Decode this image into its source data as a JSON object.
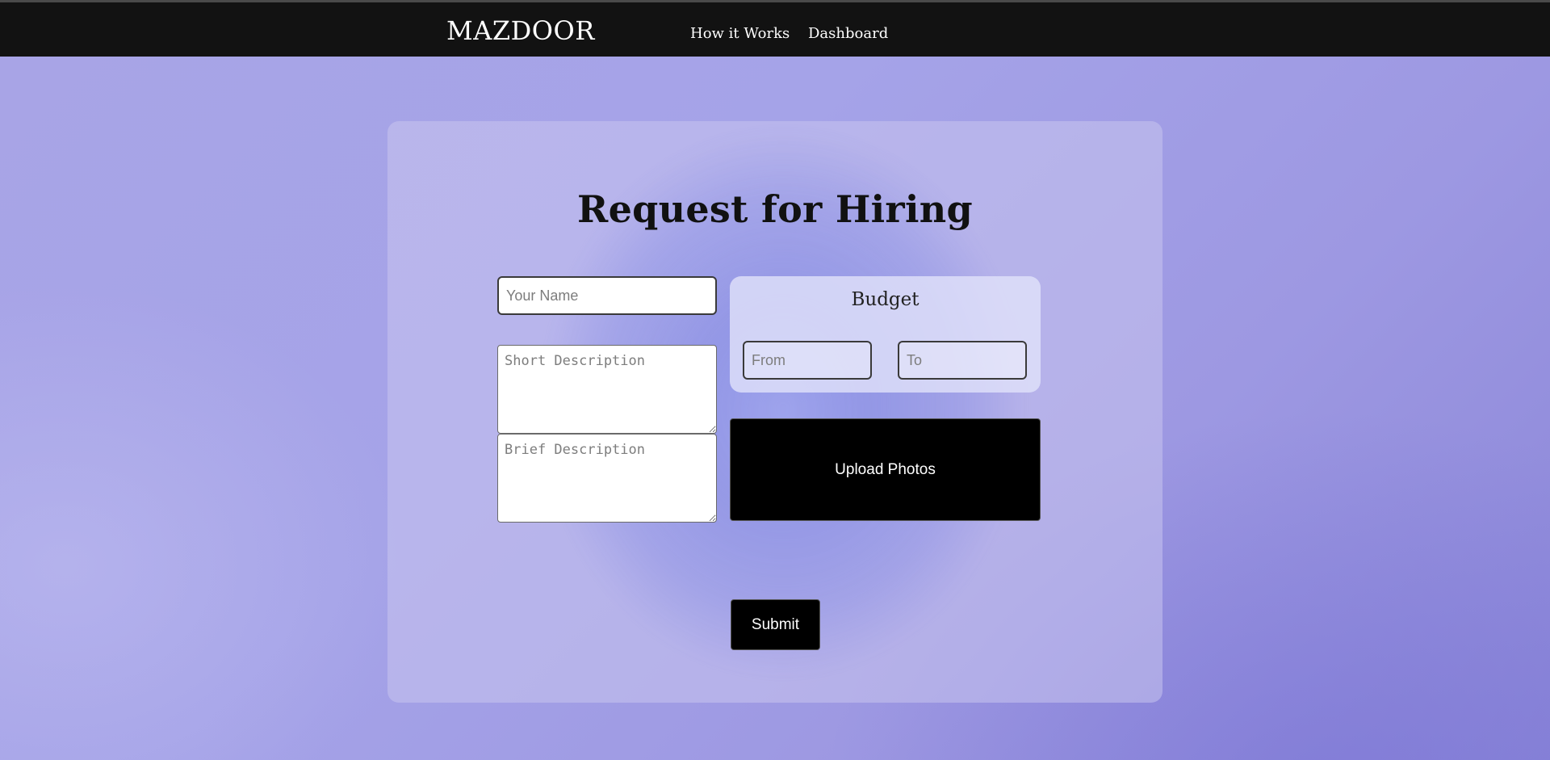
{
  "navbar": {
    "brand": "MAZDOOR",
    "links": [
      {
        "label": "How it Works"
      },
      {
        "label": "Dashboard"
      }
    ]
  },
  "form": {
    "title": "Request for Hiring",
    "name_placeholder": "Your Name",
    "short_description_placeholder": "Short Description",
    "brief_description_placeholder": "Brief Description",
    "budget": {
      "title": "Budget",
      "from_placeholder": "From",
      "to_placeholder": "To"
    },
    "upload_label": "Upload Photos",
    "submit_label": "Submit"
  },
  "colors": {
    "navbar_bg": "#121212",
    "page_bg": "#a5a3e8",
    "button_bg": "#000000"
  }
}
